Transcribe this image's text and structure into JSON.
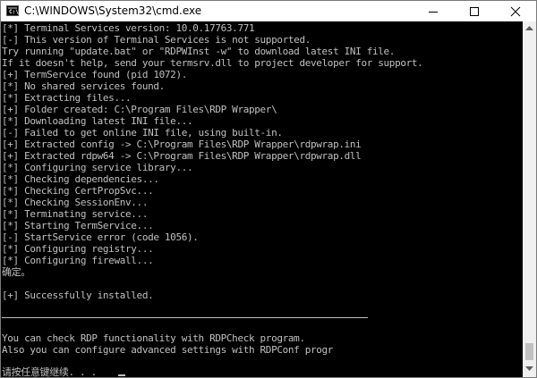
{
  "window": {
    "title": "C:\\WINDOWS\\System32\\cmd.exe",
    "icon": "cmd-icon",
    "icon_text": "C:\\",
    "controls": [
      "minimize-icon",
      "maximize-icon",
      "close-icon"
    ]
  },
  "console": {
    "lines": [
      "[*] Terminal Services version: 10.0.17763.771",
      "[-] This version of Terminal Services is not supported.",
      "Try running \"update.bat\" or \"RDPWInst -w\" to download latest INI file.",
      "If it doesn't help, send your termsrv.dll to project developer for support.",
      "[+] TermService found (pid 1072).",
      "[*] No shared services found.",
      "[*] Extracting files...",
      "[+] Folder created: C:\\Program Files\\RDP Wrapper\\",
      "[*] Downloading latest INI file...",
      "[-] Failed to get online INI file, using built-in.",
      "[+] Extracted config -> C:\\Program Files\\RDP Wrapper\\rdpwrap.ini",
      "[+] Extracted rdpw64 -> C:\\Program Files\\RDP Wrapper\\rdpwrap.dll",
      "[*] Configuring service library...",
      "[*] Checking dependencies...",
      "[*] Checking CertPropSvc...",
      "[*] Checking SessionEnv...",
      "[*] Terminating service...",
      "[*] Starting TermService...",
      "[-] StartService error (code 1056).",
      "[*] Configuring registry...",
      "[*] Configuring firewall...",
      "确定。",
      "",
      "[+] Successfully installed.",
      "",
      "",
      "",
      "You can check RDP functionality with RDPCheck program.",
      "Also you can configure advanced settings with RDPConf progr",
      "",
      "请按任意键继续. . ."
    ]
  },
  "scrollbar": {
    "up": "scroll-up-arrow-icon",
    "down": "scroll-down-arrow-icon"
  }
}
